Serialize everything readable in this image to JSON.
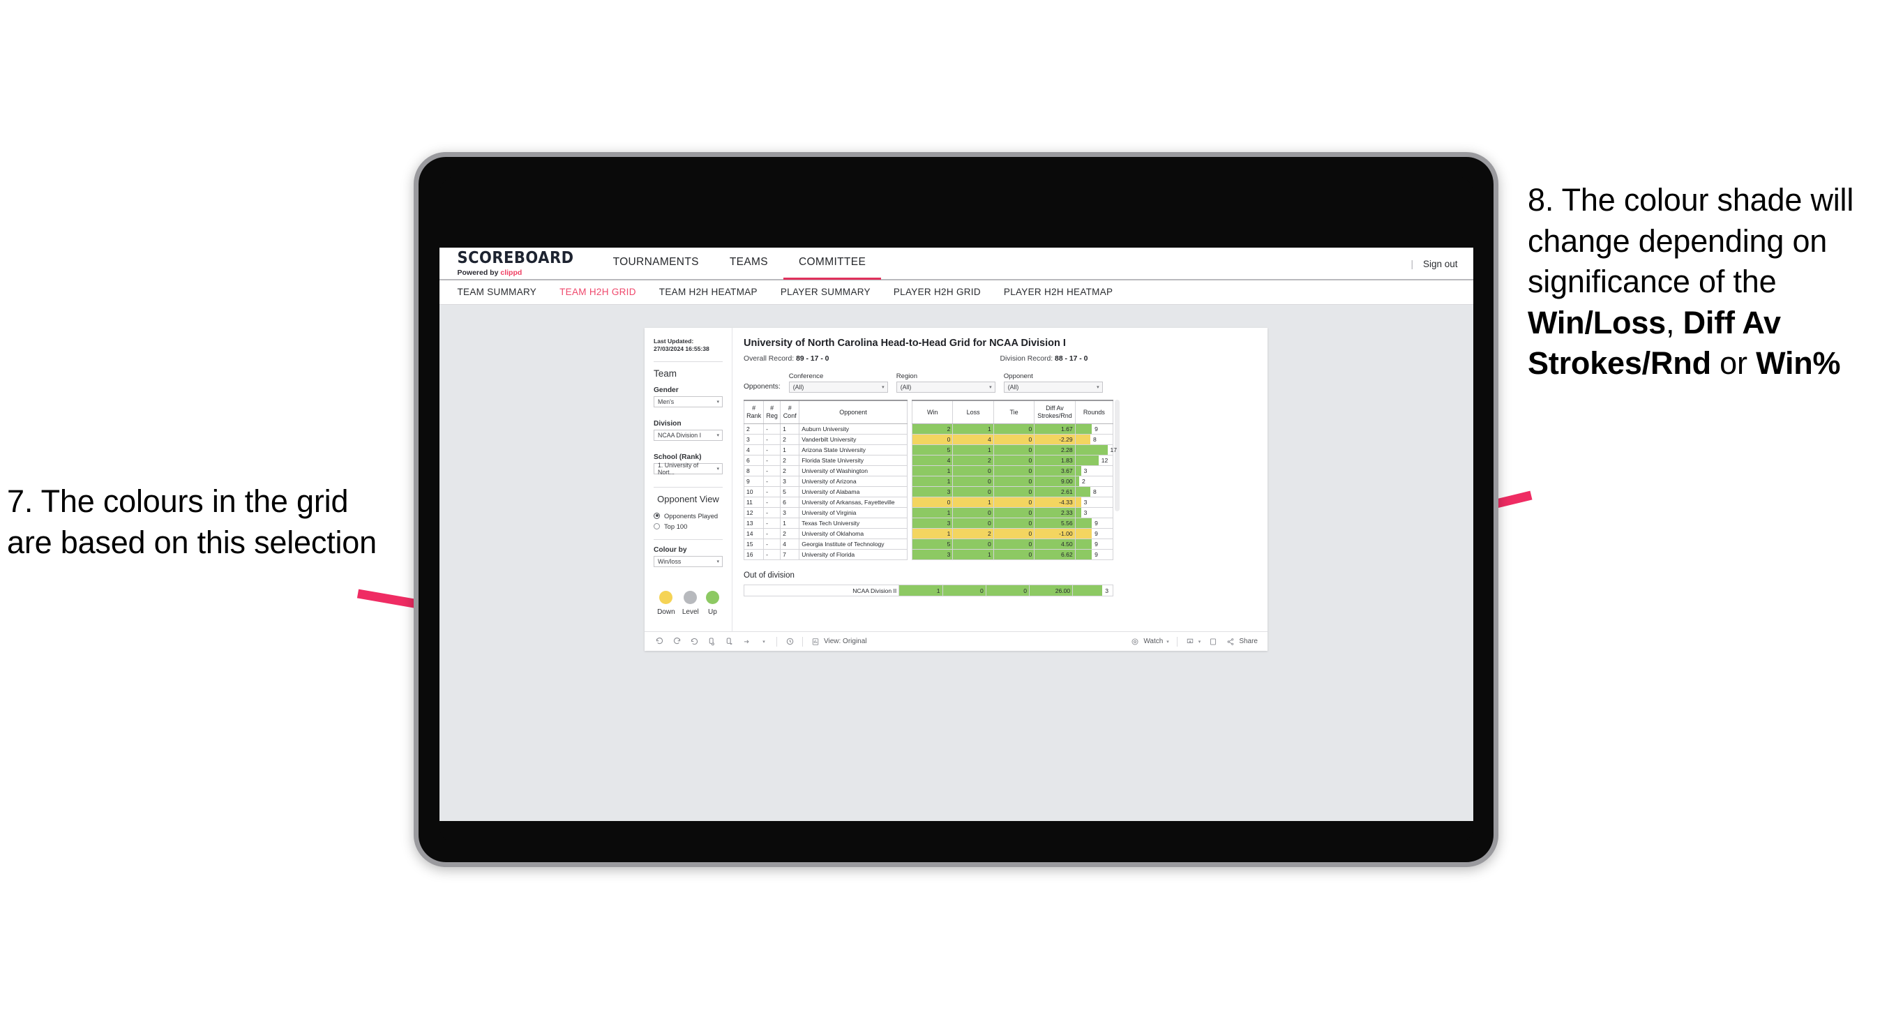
{
  "annotations": {
    "left": {
      "number": "7.",
      "text": "The colours in the grid are based on this selection"
    },
    "right": {
      "number": "8.",
      "part1": "The colour shade will change depending on significance of the ",
      "bold1": "Win/Loss",
      "mid1": ", ",
      "bold2": "Diff Av Strokes/Rnd",
      "mid2": " or ",
      "bold3": "Win%"
    },
    "arrow_color": "#ef2c63"
  },
  "app": {
    "brand": {
      "title": "SCOREBOARD",
      "powered_prefix": "Powered by ",
      "powered_name": "clippd"
    },
    "topnav": [
      {
        "label": "TOURNAMENTS",
        "active": false
      },
      {
        "label": "TEAMS",
        "active": false
      },
      {
        "label": "COMMITTEE",
        "active": true
      }
    ],
    "signout": {
      "divider": "|",
      "label": "Sign out"
    },
    "subnav": [
      {
        "label": "TEAM SUMMARY",
        "active": false
      },
      {
        "label": "TEAM H2H GRID",
        "active": true
      },
      {
        "label": "TEAM H2H HEATMAP",
        "active": false
      },
      {
        "label": "PLAYER SUMMARY",
        "active": false
      },
      {
        "label": "PLAYER H2H GRID",
        "active": false
      },
      {
        "label": "PLAYER H2H HEATMAP",
        "active": false
      }
    ]
  },
  "rail": {
    "last_updated": "Last Updated: 27/03/2024 16:55:38",
    "team_heading": "Team",
    "gender": {
      "label": "Gender",
      "value": "Men's"
    },
    "division": {
      "label": "Division",
      "value": "NCAA Division I"
    },
    "school": {
      "label": "School (Rank)",
      "value": "1. University of Nort..."
    },
    "opponent_view": {
      "heading": "Opponent View",
      "options": [
        {
          "label": "Opponents Played",
          "selected": true
        },
        {
          "label": "Top 100",
          "selected": false
        }
      ]
    },
    "colour_by": {
      "label": "Colour by",
      "value": "Win/loss"
    },
    "legend": [
      {
        "label": "Down",
        "color": "#f5d355"
      },
      {
        "label": "Level",
        "color": "#b7b9bd"
      },
      {
        "label": "Up",
        "color": "#8dc963"
      }
    ]
  },
  "viz": {
    "title": "University of North Carolina Head-to-Head Grid for NCAA Division I",
    "overall_record_label": "Overall Record: ",
    "overall_record_value": "89 - 17 - 0",
    "division_record_label": "Division Record: ",
    "division_record_value": "88 - 17 - 0",
    "opponents_label": "Opponents:",
    "filters": [
      {
        "label": "Conference",
        "value": "(All)"
      },
      {
        "label": "Region",
        "value": "(All)"
      },
      {
        "label": "Opponent",
        "value": "(All)"
      }
    ],
    "columns": [
      {
        "key": "rank",
        "line1": "#",
        "line2": "Rank"
      },
      {
        "key": "reg",
        "line1": "#",
        "line2": "Reg"
      },
      {
        "key": "conf",
        "line1": "#",
        "line2": "Conf"
      },
      {
        "key": "opponent",
        "line1": "Opponent",
        "line2": ""
      },
      {
        "key": "win",
        "line1": "Win",
        "line2": ""
      },
      {
        "key": "loss",
        "line1": "Loss",
        "line2": ""
      },
      {
        "key": "tie",
        "line1": "Tie",
        "line2": ""
      },
      {
        "key": "diff",
        "line1": "Diff Av",
        "line2": "Strokes/Rnd"
      },
      {
        "key": "rounds",
        "line1": "Rounds",
        "line2": ""
      }
    ],
    "rows": [
      {
        "rank": "2",
        "reg": "-",
        "conf": "1",
        "opponent": "Auburn University",
        "win": "2",
        "loss": "1",
        "tie": "0",
        "diff": "1.67",
        "rounds": "9",
        "rounds_pct": 44,
        "color": "up"
      },
      {
        "rank": "3",
        "reg": "-",
        "conf": "2",
        "opponent": "Vanderbilt University",
        "win": "0",
        "loss": "4",
        "tie": "0",
        "diff": "-2.29",
        "rounds": "8",
        "rounds_pct": 40,
        "color": "down"
      },
      {
        "rank": "4",
        "reg": "-",
        "conf": "1",
        "opponent": "Arizona State University",
        "win": "5",
        "loss": "1",
        "tie": "0",
        "diff": "2.28",
        "rounds": "17",
        "rounds_pct": 86,
        "color": "up"
      },
      {
        "rank": "6",
        "reg": "-",
        "conf": "2",
        "opponent": "Florida State University",
        "win": "4",
        "loss": "2",
        "tie": "0",
        "diff": "1.83",
        "rounds": "12",
        "rounds_pct": 62,
        "color": "up"
      },
      {
        "rank": "8",
        "reg": "-",
        "conf": "2",
        "opponent": "University of Washington",
        "win": "1",
        "loss": "0",
        "tie": "0",
        "diff": "3.67",
        "rounds": "3",
        "rounds_pct": 15,
        "color": "up"
      },
      {
        "rank": "9",
        "reg": "-",
        "conf": "3",
        "opponent": "University of Arizona",
        "win": "1",
        "loss": "0",
        "tie": "0",
        "diff": "9.00",
        "rounds": "2",
        "rounds_pct": 10,
        "color": "up"
      },
      {
        "rank": "10",
        "reg": "-",
        "conf": "5",
        "opponent": "University of Alabama",
        "win": "3",
        "loss": "0",
        "tie": "0",
        "diff": "2.61",
        "rounds": "8",
        "rounds_pct": 40,
        "color": "up"
      },
      {
        "rank": "11",
        "reg": "-",
        "conf": "6",
        "opponent": "University of Arkansas, Fayetteville",
        "win": "0",
        "loss": "1",
        "tie": "0",
        "diff": "-4.33",
        "rounds": "3",
        "rounds_pct": 15,
        "color": "down"
      },
      {
        "rank": "12",
        "reg": "-",
        "conf": "3",
        "opponent": "University of Virginia",
        "win": "1",
        "loss": "0",
        "tie": "0",
        "diff": "2.33",
        "rounds": "3",
        "rounds_pct": 15,
        "color": "up"
      },
      {
        "rank": "13",
        "reg": "-",
        "conf": "1",
        "opponent": "Texas Tech University",
        "win": "3",
        "loss": "0",
        "tie": "0",
        "diff": "5.56",
        "rounds": "9",
        "rounds_pct": 44,
        "color": "up"
      },
      {
        "rank": "14",
        "reg": "-",
        "conf": "2",
        "opponent": "University of Oklahoma",
        "win": "1",
        "loss": "2",
        "tie": "0",
        "diff": "-1.00",
        "rounds": "9",
        "rounds_pct": 44,
        "color": "down"
      },
      {
        "rank": "15",
        "reg": "-",
        "conf": "4",
        "opponent": "Georgia Institute of Technology",
        "win": "5",
        "loss": "0",
        "tie": "0",
        "diff": "4.50",
        "rounds": "9",
        "rounds_pct": 44,
        "color": "up"
      },
      {
        "rank": "16",
        "reg": "-",
        "conf": "7",
        "opponent": "University of Florida",
        "win": "3",
        "loss": "1",
        "tie": "0",
        "diff": "6.62",
        "rounds": "9",
        "rounds_pct": 44,
        "color": "up"
      }
    ],
    "out_of_division": {
      "title": "Out of division",
      "row": {
        "opponent": "NCAA Division II",
        "win": "1",
        "loss": "0",
        "tie": "0",
        "diff": "26.00",
        "rounds": "3",
        "rounds_pct": 74,
        "color": "up"
      }
    },
    "colors": {
      "up": "#8dc963",
      "down": "#f3d560",
      "level": "#b7b9bd"
    }
  },
  "toolbar": {
    "undo": "undo-icon",
    "redo": "redo-icon",
    "revert": "revert-icon",
    "refresh": "refresh-data-icon",
    "pause": "pause-icon",
    "alerts": "alert-icon",
    "view_label": "View: Original",
    "watch_label": "Watch",
    "share_label": "Share"
  }
}
